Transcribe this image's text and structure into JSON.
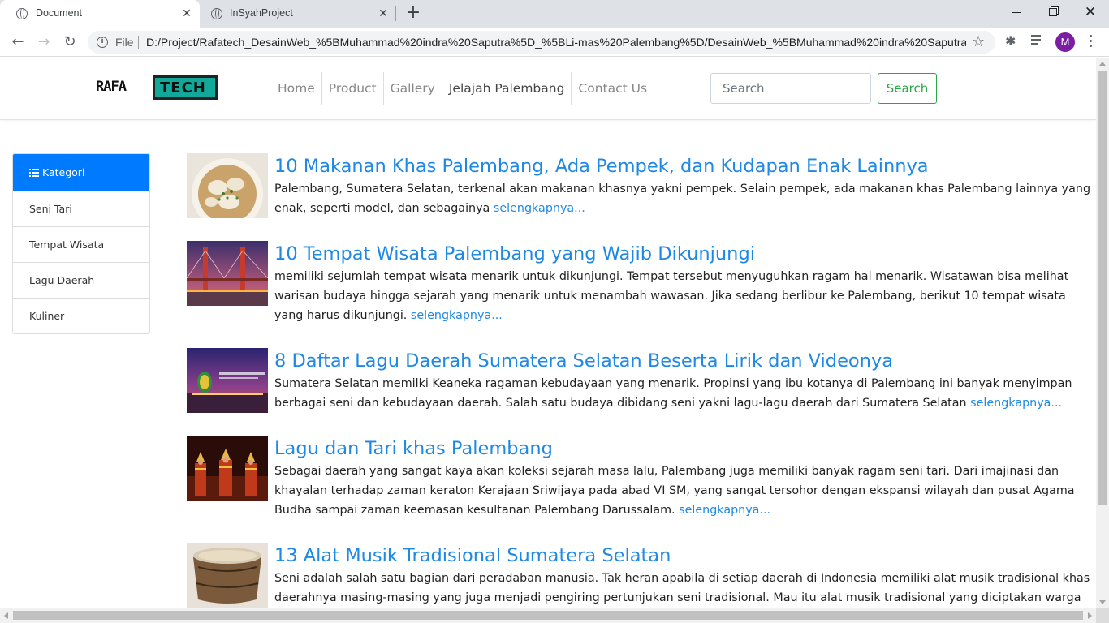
{
  "browser": {
    "tabs": [
      {
        "title": "Document",
        "active": true
      },
      {
        "title": "InSyahProject",
        "active": false
      }
    ],
    "scheme_label": "File",
    "url": "D:/Project/Rafatech_DesainWeb_%5BMuhammad%20indra%20Saputra%5D_%5BLi-mas%20Palembang%5D/DesainWeb_%5BMuhammad%20indra%20Saputra%...",
    "profile_initial": "M"
  },
  "site": {
    "logo": {
      "left": "RAFA",
      "right": "TECH"
    },
    "menu": [
      "Home",
      "Product",
      "Gallery",
      "Jelajah Palembang",
      "Contact Us"
    ],
    "active_menu": "Jelajah Palembang",
    "search": {
      "placeholder": "Search",
      "button": "Search"
    },
    "colors": {
      "primary": "#007bff",
      "link": "#1e88e5",
      "success": "#28a745",
      "logo_box": "#12a99a"
    }
  },
  "sidebar": {
    "header": "Kategori",
    "items": [
      "Seni Tari",
      "Tempat Wisata",
      "Lagu Daerah",
      "Kuliner"
    ]
  },
  "articles": [
    {
      "title": "10 Makanan Khas Palembang, Ada Pempek, dan Kudapan Enak Lainnya",
      "text": "Palembang, Sumatera Selatan, terkenal akan makanan khasnya yakni pempek. Selain pempek, ada makanan khas Palembang lainnya yang enak, seperti model, dan sebagainya ",
      "more": "selengkapnya..."
    },
    {
      "title": "10 Tempat Wisata Palembang yang Wajib Dikunjungi",
      "text": "memiliki sejumlah tempat wisata menarik untuk dikunjungi. Tempat tersebut menyuguhkan ragam hal menarik. Wisatawan bisa melihat warisan budaya hingga sejarah yang menarik untuk menambah wawasan. Jika sedang berlibur ke Palembang, berikut 10 tempat wisata yang harus dikunjungi. ",
      "more": "selengkapnya..."
    },
    {
      "title": "8 Daftar Lagu Daerah Sumatera Selatan Beserta Lirik dan Videonya",
      "text": "Sumatera Selatan memilki Keaneka ragaman kebudayaan yang menarik. Propinsi yang ibu kotanya di Palembang ini banyak menyimpan berbagai seni dan kebudayaan daerah. Salah satu budaya dibidang seni yakni lagu-lagu daerah dari Sumatera Selatan ",
      "more": "selengkapnya..."
    },
    {
      "title": "Lagu dan Tari khas Palembang",
      "text": "Sebagai daerah yang sangat kaya akan koleksi sejarah masa lalu, Palembang juga memiliki banyak ragam seni tari. Dari imajinasi dan khayalan terhadap zaman keraton Kerajaan Sriwijaya pada abad VI SM, yang sangat tersohor dengan ekspansi wilayah dan pusat Agama Budha sampai zaman keemasan kesultanan Palembang Darussalam. ",
      "more": "selengkapnya..."
    },
    {
      "title": "13 Alat Musik Tradisional Sumatera Selatan",
      "text": "Seni adalah salah satu bagian dari peradaban manusia. Tak heran apabila di setiap daerah di Indonesia memiliki alat musik tradisional khas daerahnya masing-masing yang juga menjadi pengiring pertunjukan seni tradisional. Mau itu alat musik tradisional yang diciptakan warga",
      "more": ""
    }
  ]
}
